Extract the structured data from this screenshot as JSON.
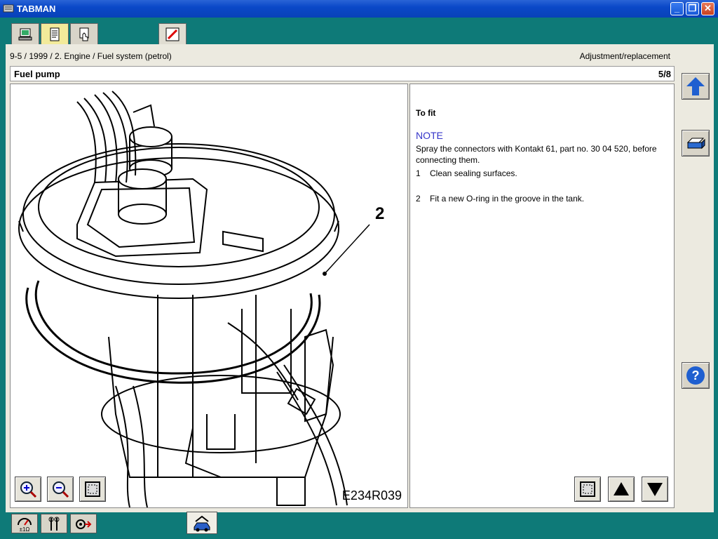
{
  "window": {
    "title": "TABMAN"
  },
  "breadcrumb": "9-5 / 1999 / 2. Engine / Fuel system (petrol)",
  "mode": "Adjustment/replacement",
  "page": {
    "title": "Fuel pump",
    "number": "5/8"
  },
  "content": {
    "heading": "To fit",
    "note_label": "NOTE",
    "note_text": "Spray the connectors with Kontakt 61, part no. 30 04 520, before connecting them.",
    "steps": [
      {
        "num": "1",
        "text": "Clean sealing surfaces."
      },
      {
        "num": "2",
        "text": "Fit a new O-ring in the groove in the tank."
      }
    ]
  },
  "illustration": {
    "callout": "2",
    "reference": "E234R039"
  },
  "colors": {
    "background": "#0e7a78",
    "panel": "#eceae0",
    "note": "#3434c8",
    "accent_blue": "#1f5fd0"
  },
  "icons": {
    "top_tabs": [
      "computer-icon",
      "document-icon",
      "hand-pointer-icon",
      "pen-edit-icon"
    ],
    "image_tools": [
      "zoom-in-icon",
      "zoom-out-icon",
      "fit-frame-icon"
    ],
    "nav": [
      "frame-icon",
      "arrow-up-icon",
      "arrow-down-icon"
    ],
    "side": [
      "up-arrow-icon",
      "print-icon",
      "help-icon"
    ],
    "bottom_tabs": [
      "multimeter-icon",
      "wrench-icon",
      "diagnostics-icon",
      "car-home-icon"
    ]
  }
}
